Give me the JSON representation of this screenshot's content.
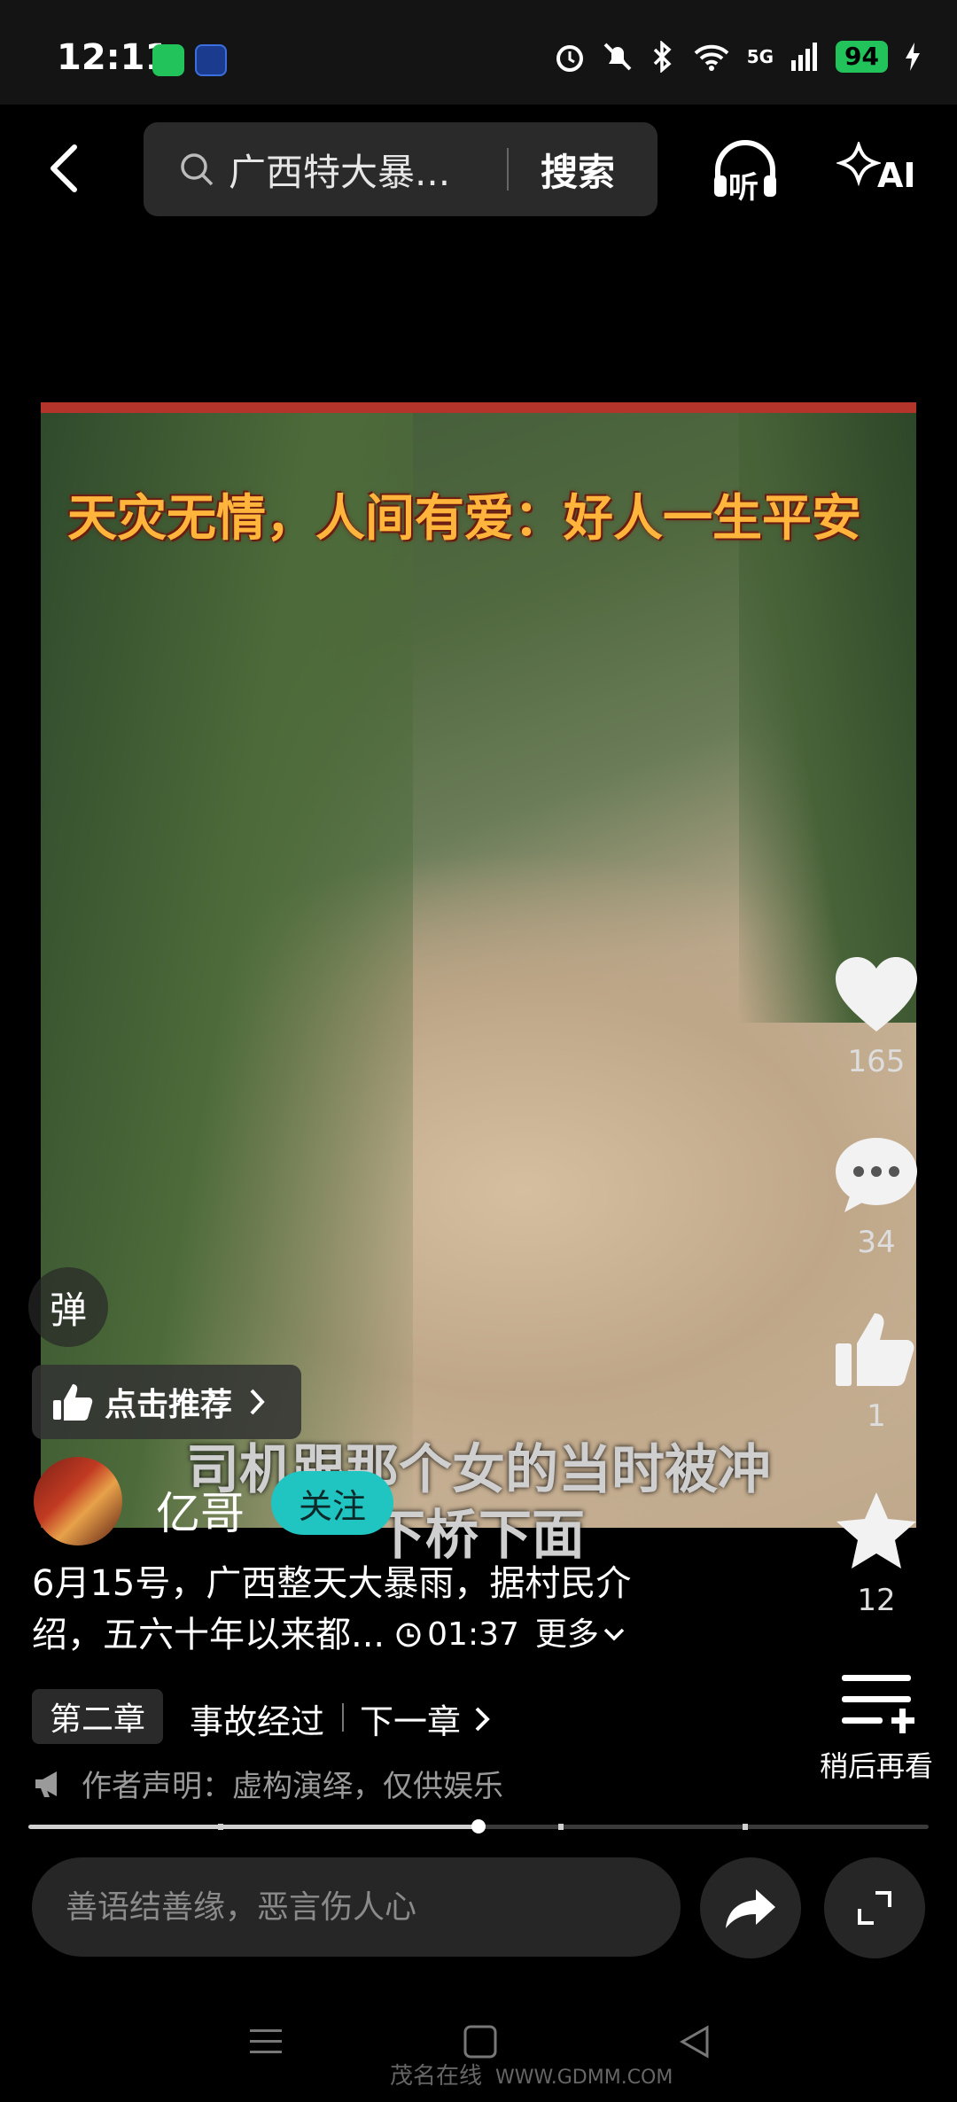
{
  "status_bar": {
    "time": "12:11",
    "network": "5G",
    "battery": "94"
  },
  "top_bar": {
    "search_query": "广西特大暴...",
    "search_button": "搜索",
    "listen_label": "听",
    "ai_label": "AI"
  },
  "video": {
    "headline": "天灾无情，人间有爱：好人一生平安",
    "subtitle_line1": "司机跟那个女的当时被冲",
    "subtitle_line2": "下桥下面",
    "progress": 0.5
  },
  "actions": {
    "like_count": "165",
    "comment_count": "34",
    "thumb_count": "1",
    "favorite_count": "12",
    "watch_later_label": "稍后再看"
  },
  "danmaku_label": "弹",
  "recommend_label": "点击推荐",
  "author": {
    "name": "亿哥",
    "follow_label": "关注"
  },
  "description": {
    "line1": "6月15号，广西整天大暴雨，据村民介",
    "line2": "绍，五六十年以来都...",
    "duration": "01:37",
    "more_label": "更多"
  },
  "chapter": {
    "badge": "第二章",
    "title": "事故经过",
    "next_label": "下一章"
  },
  "declaration": "作者声明：虚构演绎，仅供娱乐",
  "comment_input": {
    "placeholder": "善语结善缘，恶言伤人心"
  },
  "watermark": {
    "brand": "茂名在线",
    "url": "WWW.GDMM.COM"
  }
}
